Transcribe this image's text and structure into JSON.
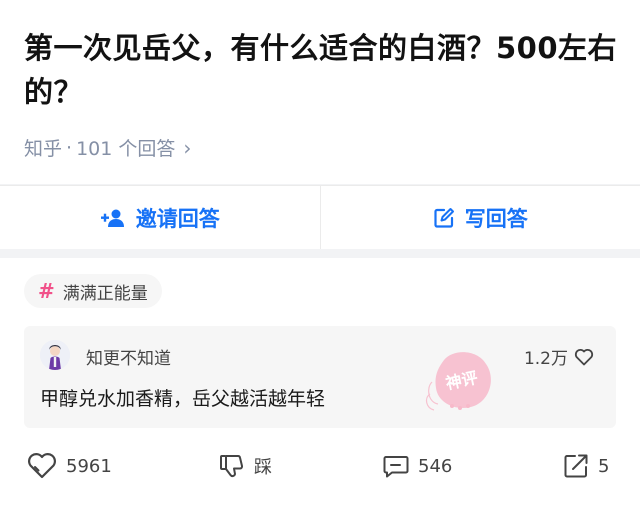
{
  "question": {
    "title": "第一次见岳父，有什么适合的白酒？500左右的？",
    "source": "知乎",
    "separator": "·",
    "answers_count": "101 个回答"
  },
  "actions": {
    "invite_label": "邀请回答",
    "write_label": "写回答"
  },
  "topic_tag": {
    "label": "满满正能量"
  },
  "answer": {
    "author": "知更不知道",
    "likes": "1.2万",
    "text": "甲醇兑水加香精，岳父越活越年轻",
    "stamp_text": "神评"
  },
  "bottom_bar": {
    "upvotes": "5961",
    "downvote_label": "踩",
    "comments": "546",
    "shares": "5"
  },
  "colors": {
    "accent": "#1772f6",
    "tag_hash": "#f1528a",
    "muted": "#8590a6",
    "stamp": "#f18aa6"
  }
}
